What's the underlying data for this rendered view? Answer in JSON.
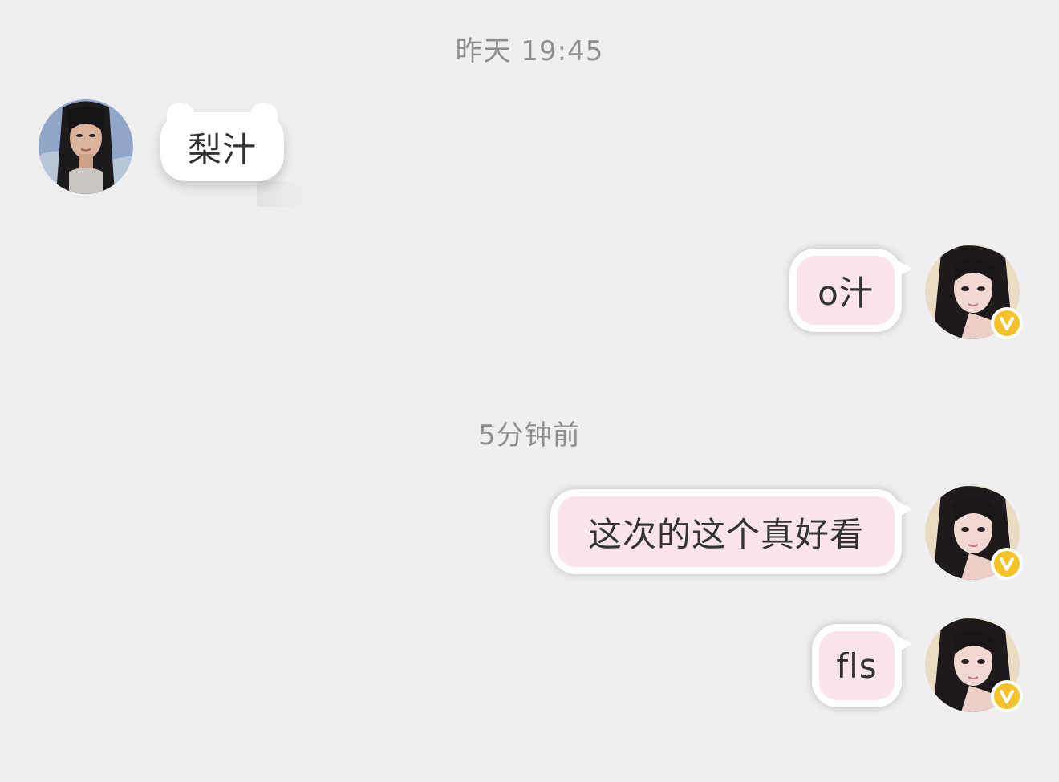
{
  "chat": {
    "timestamp_1": "昨天 19:45",
    "timestamp_2": "5分钟前",
    "messages": [
      {
        "sender": "other",
        "text": "梨汁"
      },
      {
        "sender": "me",
        "text": "o汁"
      },
      {
        "sender": "me",
        "text": "这次的这个真好看"
      },
      {
        "sender": "me",
        "text": "fls"
      }
    ]
  },
  "colors": {
    "background": "#efefef",
    "timestamp_text": "#8e8e8e",
    "incoming_bubble": "#ffffff",
    "outgoing_bubble": "#fbe4ea",
    "outgoing_border": "#ffffff",
    "vip_badge": "#f6c229"
  },
  "icons": {
    "vip_badge": "vip-v-badge-icon"
  }
}
